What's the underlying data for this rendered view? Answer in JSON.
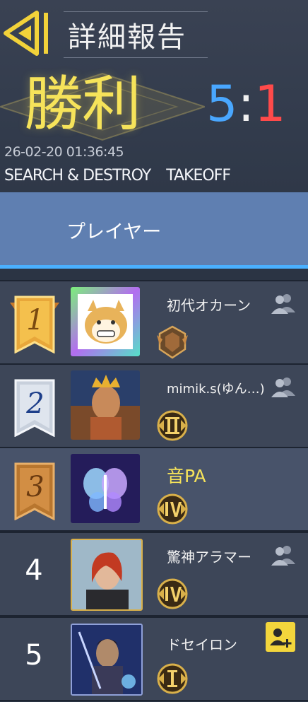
{
  "header": {
    "title": "詳細報告",
    "result": "勝利",
    "score_blue": "5",
    "score_sep": ":",
    "score_red": "1",
    "datetime": "26-02-20 01:36:45",
    "mode": "SEARCH & DESTROY",
    "map": "TAKEOFF"
  },
  "tabs": {
    "active_label": "プレイヤー"
  },
  "players": [
    {
      "rank": "1",
      "name": "初代オカーン",
      "tier_icon": "tier-legendary-crest-icon",
      "action_icon": "friend-icon"
    },
    {
      "rank": "2",
      "name": "mimik.s(ゆん…)",
      "tier_icon": "tier-roman-ii-icon",
      "action_icon": "friend-icon"
    },
    {
      "rank": "3",
      "name": "音PA",
      "tier_icon": "tier-roman-iv-icon",
      "action_icon": ""
    },
    {
      "rank": "4",
      "name": "驚神アラマー",
      "tier_icon": "tier-roman-iv-icon",
      "action_icon": "friend-icon"
    },
    {
      "rank": "5",
      "name": "ドセイロン",
      "tier_icon": "tier-roman-i-icon",
      "action_icon": "add-friend-icon"
    }
  ],
  "colors": {
    "accent_yellow": "#f6e35a",
    "team_blue": "#49a7ff",
    "team_red": "#ff4a4a",
    "tab_bg": "#5f7fb1",
    "tab_underline": "#4ab0ff"
  }
}
